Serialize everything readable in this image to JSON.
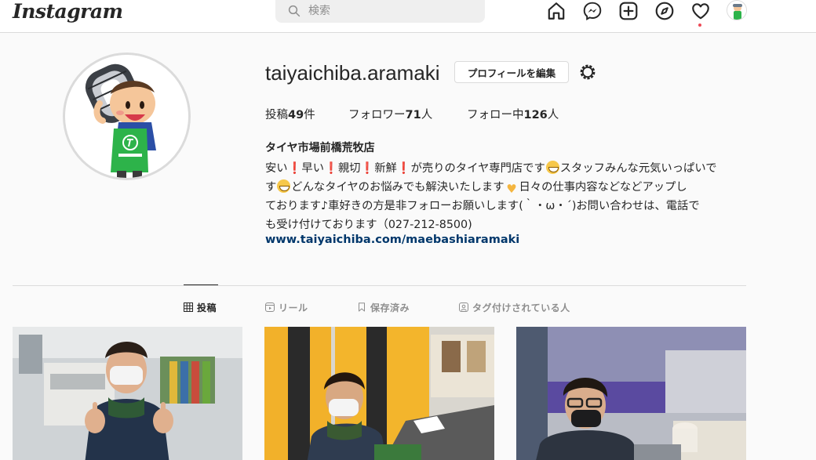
{
  "header": {
    "logo": "Instagram",
    "search_placeholder": "検索"
  },
  "nav": {
    "icons": [
      "home-icon",
      "messenger-icon",
      "new-post-icon",
      "explore-icon",
      "activity-icon",
      "profile-avatar"
    ]
  },
  "profile": {
    "username": "taiyaichiba.aramaki",
    "edit_button": "プロフィールを編集",
    "stats": {
      "posts_label": "投稿",
      "posts_count": "49",
      "posts_unit": "件",
      "followers_label": "フォロワー",
      "followers_count": "71",
      "followers_unit": "人",
      "following_label": "フォロー中",
      "following_count": "126",
      "following_unit": "人"
    },
    "full_name": "タイヤ市場前橋荒牧店",
    "bio": {
      "l1_a": "安い",
      "l1_b": "早い",
      "l1_c": "親切",
      "l1_d": "新鮮",
      "l1_e": "が売りのタイヤ専門店です",
      "l1_f": "スタッフみんな元気いっぱいで",
      "l2_a": "す",
      "l2_b": "どんなタイヤのお悩みでも解決いたします",
      "l2_c": "日々の仕事内容などなどアップし",
      "l3": "ております♪車好きの方是非フォローお願いします(｀・ω・´)お問い合わせは、電話で",
      "l4": "も受け付けております（027-212-8500)"
    },
    "website": "www.taiyaichiba.com/maebashiaramaki"
  },
  "tabs": [
    {
      "label": "投稿",
      "icon": "grid-icon",
      "active": true
    },
    {
      "label": "リール",
      "icon": "reels-icon",
      "active": false
    },
    {
      "label": "保存済み",
      "icon": "bookmark-icon",
      "active": false
    },
    {
      "label": "タグ付けされている人",
      "icon": "tagged-icon",
      "active": false
    }
  ],
  "posts": [
    {
      "subject": "staff-thumbs-up-office"
    },
    {
      "subject": "staff-with-yellow-banner"
    },
    {
      "subject": "staff-with-glasses-tires"
    }
  ],
  "colors": {
    "link": "#00376b",
    "border": "#dbdbdb",
    "background": "#fafafa",
    "notification": "#ed4956",
    "mascot_green": "#2db34a"
  }
}
